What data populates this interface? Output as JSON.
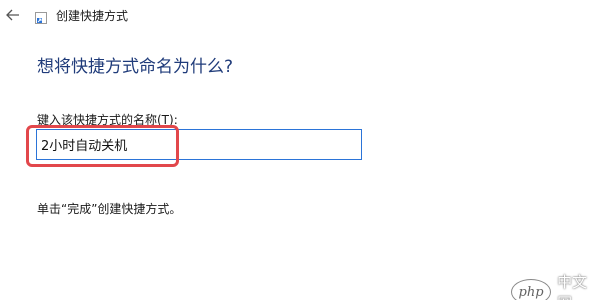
{
  "window": {
    "title": "创建快捷方式",
    "back_icon": "back-arrow-icon",
    "app_icon": "shortcut-app-icon"
  },
  "main": {
    "heading": "想将快捷方式命名为什么?",
    "field_label": "键入该快捷方式的名称(T):",
    "name_value": "2小时自动关机",
    "hint": "单击“完成”创建快捷方式。"
  },
  "annotation": {
    "highlight_color": "#e2474b"
  },
  "watermark": {
    "logo_text": "php",
    "site_text": "中文网"
  },
  "colors": {
    "heading": "#1f3b7a",
    "input_border": "#2b74d8"
  }
}
